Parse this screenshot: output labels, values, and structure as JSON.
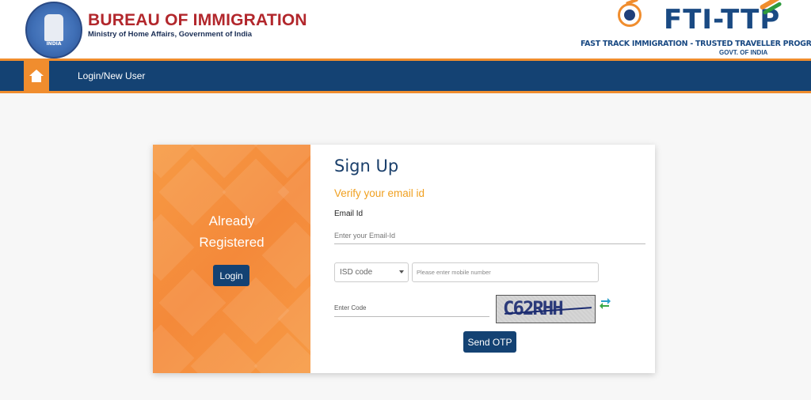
{
  "header": {
    "emblem_text": "INDIA",
    "bureau_title": "BUREAU OF IMMIGRATION",
    "bureau_subtitle": "Ministry of Home Affairs, Government of India",
    "fti_title": "FTI-TTP",
    "fti_subtitle": "FAST TRACK IMMIGRATION - TRUSTED TRAVELLER PROGRAM",
    "fti_govt": "GOVT. OF INDIA"
  },
  "nav": {
    "home_icon": "home-icon",
    "link_label": "Login/New User"
  },
  "left_panel": {
    "line1": "Already",
    "line2": "Registered",
    "login_label": "Login"
  },
  "form": {
    "title": "Sign Up",
    "subtitle": "Verify your email id",
    "email_label": "Email Id",
    "email_placeholder": "Enter your Email-Id",
    "isd_value": "ISD code",
    "mobile_placeholder": "Please enter mobile number",
    "code_placeholder": "Enter Code",
    "captcha_text": "C62RHH",
    "send_otp_label": "Send OTP"
  },
  "colors": {
    "navy": "#144273",
    "orange": "#f08d2e",
    "red": "#b2272c",
    "amber": "#f0a020"
  }
}
